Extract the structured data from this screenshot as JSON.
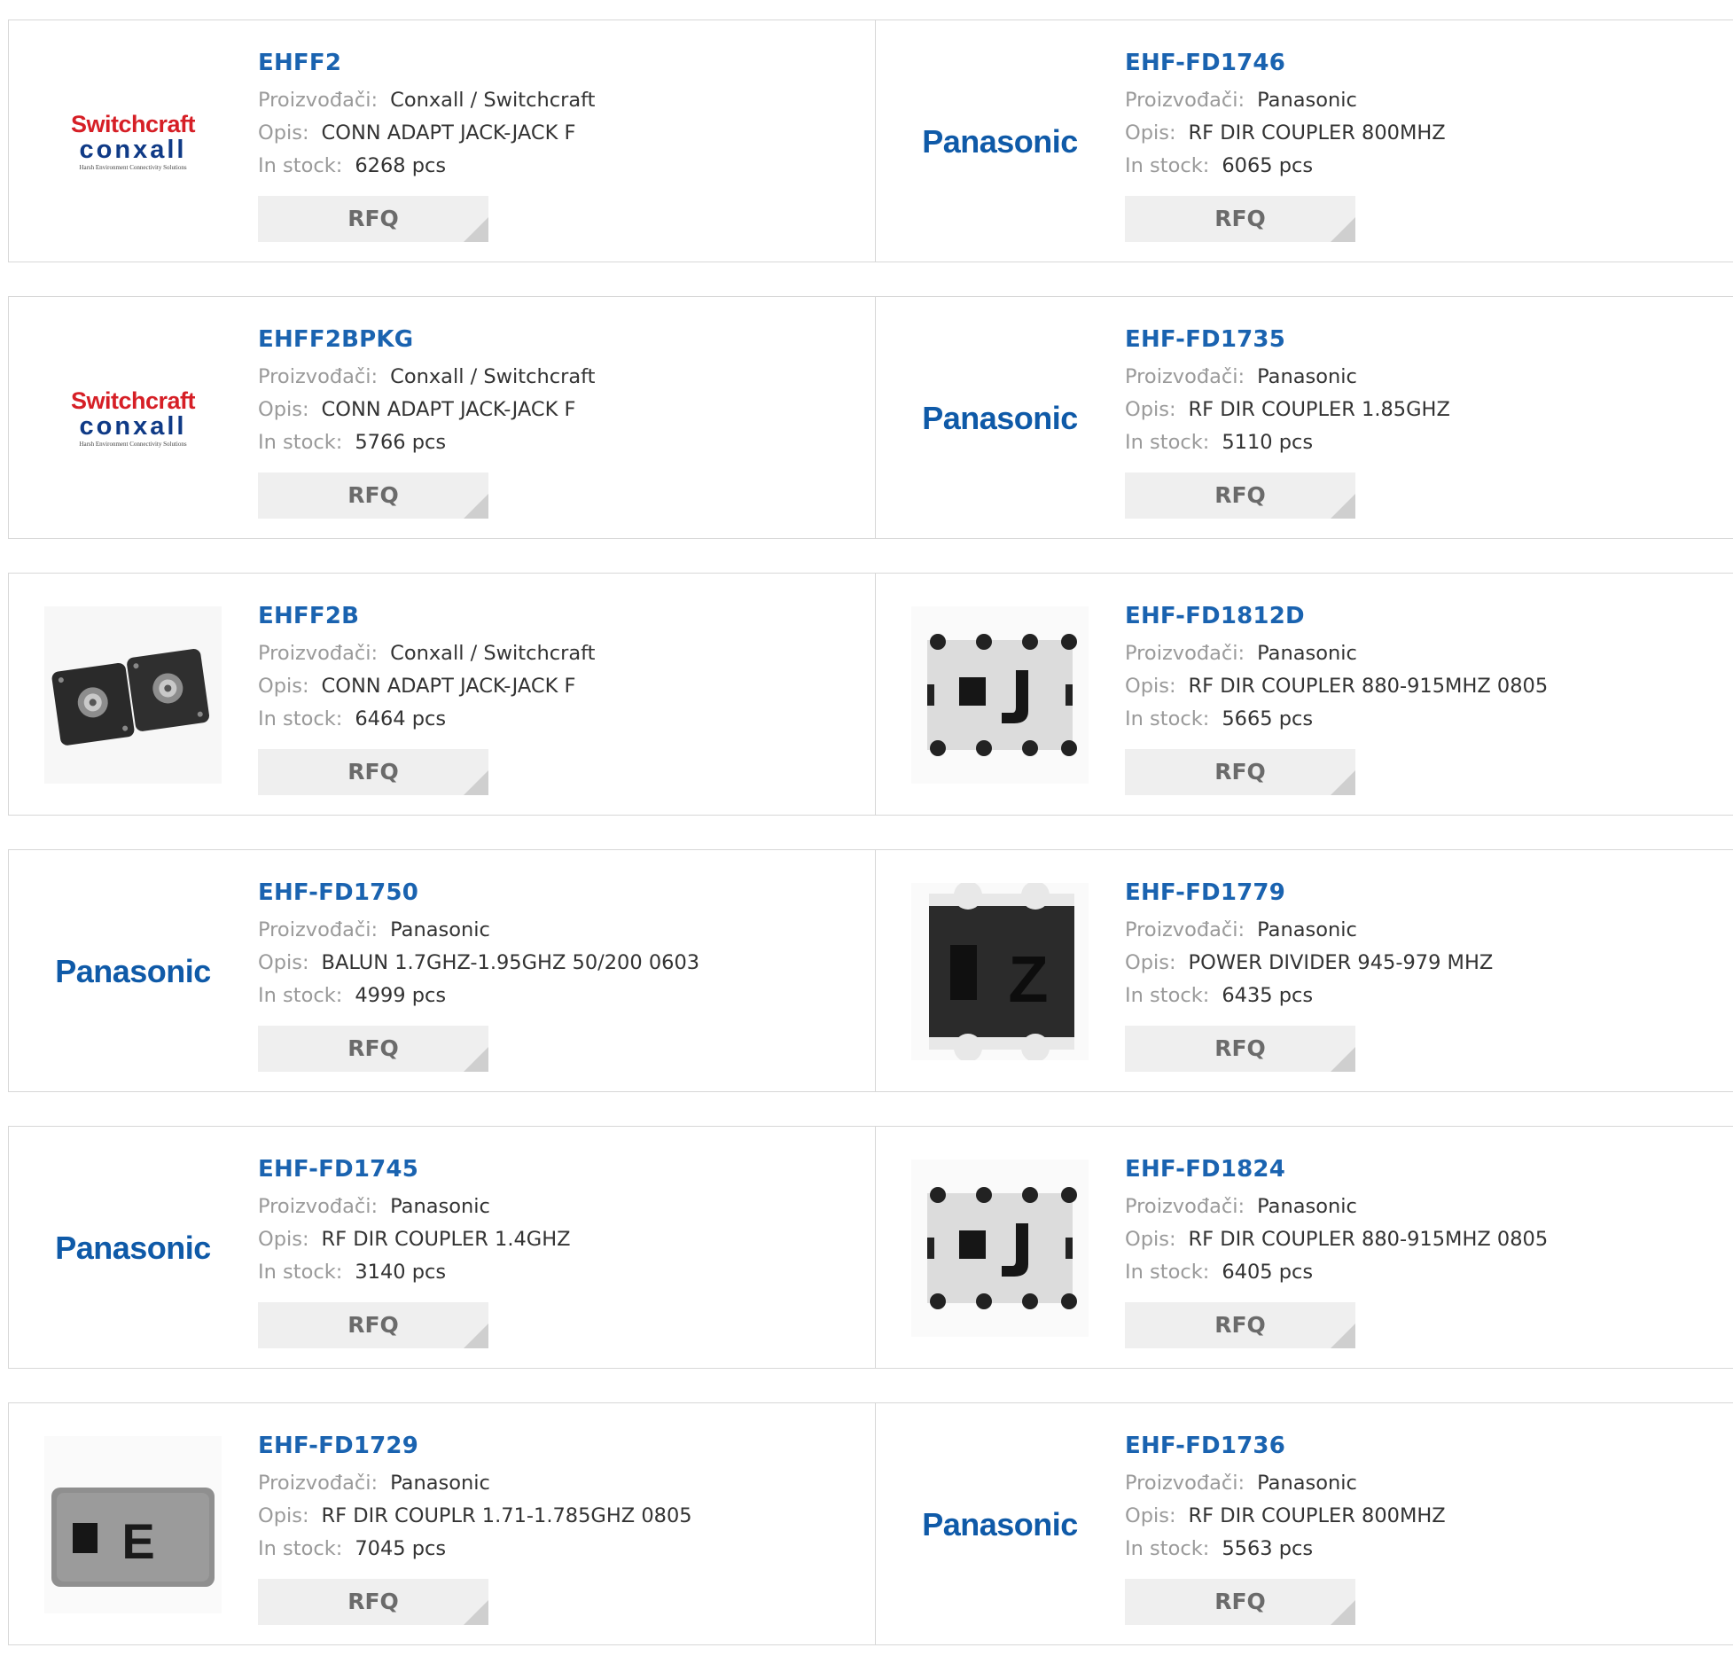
{
  "labels": {
    "manufacturer": "Proizvođači:",
    "description": "Opis:",
    "stock": "In stock:",
    "rfq": "RFQ"
  },
  "products": [
    {
      "name": "EHFF2",
      "manufacturer": "Conxall / Switchcraft",
      "description": "CONN ADAPT JACK-JACK F",
      "stock": "6268 pcs",
      "image": "switchcraft-conxall-logo"
    },
    {
      "name": "EHF-FD1746",
      "manufacturer": "Panasonic",
      "description": "RF DIR COUPLER 800MHZ",
      "stock": "6065 pcs",
      "image": "panasonic-logo"
    },
    {
      "name": "EHFF2BPKG",
      "manufacturer": "Conxall / Switchcraft",
      "description": "CONN ADAPT JACK-JACK F",
      "stock": "5766 pcs",
      "image": "switchcraft-conxall-logo"
    },
    {
      "name": "EHF-FD1735",
      "manufacturer": "Panasonic",
      "description": "RF DIR COUPLER 1.85GHZ",
      "stock": "5110 pcs",
      "image": "panasonic-logo"
    },
    {
      "name": "EHFF2B",
      "manufacturer": "Conxall / Switchcraft",
      "description": "CONN ADAPT JACK-JACK F",
      "stock": "6464 pcs",
      "image": "connector-plate-photo"
    },
    {
      "name": "EHF-FD1812D",
      "manufacturer": "Panasonic",
      "description": "RF DIR COUPLER 880-915MHZ 0805",
      "stock": "5665 pcs",
      "image": "chip-j-photo"
    },
    {
      "name": "EHF-FD1750",
      "manufacturer": "Panasonic",
      "description": "BALUN 1.7GHZ-1.95GHZ 50/200 0603",
      "stock": "4999 pcs",
      "image": "panasonic-logo"
    },
    {
      "name": "EHF-FD1779",
      "manufacturer": "Panasonic",
      "description": "POWER DIVIDER 945-979 MHZ",
      "stock": "6435 pcs",
      "image": "chip-z-photo"
    },
    {
      "name": "EHF-FD1745",
      "manufacturer": "Panasonic",
      "description": "RF DIR COUPLER 1.4GHZ",
      "stock": "3140 pcs",
      "image": "panasonic-logo"
    },
    {
      "name": "EHF-FD1824",
      "manufacturer": "Panasonic",
      "description": "RF DIR COUPLER 880-915MHZ 0805",
      "stock": "6405 pcs",
      "image": "chip-j-photo"
    },
    {
      "name": "EHF-FD1729",
      "manufacturer": "Panasonic",
      "description": "RF DIR COUPLR 1.71-1.785GHZ 0805",
      "stock": "7045 pcs",
      "image": "chip-e-photo"
    },
    {
      "name": "EHF-FD1736",
      "manufacturer": "Panasonic",
      "description": "RF DIR COUPLER 800MHZ",
      "stock": "5563 pcs",
      "image": "panasonic-logo"
    }
  ],
  "logos": {
    "panasonic": "Panasonic",
    "switchcraft": "Switchcraft",
    "conxall": "conxall",
    "conxall_tagline": "Harsh Environment Connectivity Solutions"
  }
}
